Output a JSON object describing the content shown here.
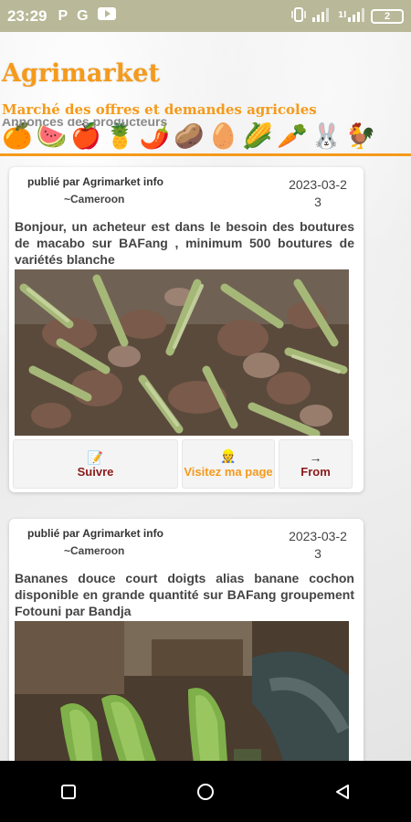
{
  "status_bar": {
    "time": "23:29",
    "left_icons": [
      "P",
      "G",
      "▶"
    ],
    "battery": "2"
  },
  "header": {
    "title": "Agrimarket",
    "subtitle": "Marché des offres et demandes agricoles",
    "emojis": [
      "🍊",
      "🍉",
      "🍎",
      "🍍",
      "🌶️",
      "🥔",
      "🥚",
      "🌽",
      "🥕",
      "🐰",
      "🐓"
    ]
  },
  "section": {
    "heading": "Annonces des producteurs"
  },
  "posts": [
    {
      "author": "publié par Agrimarket info",
      "location": "~Cameroon",
      "date": "2023-03-23",
      "text": "Bonjour, un acheteur est dans le besoin des boutures de macabo sur BAFang , minimum 500 boutures de variétés blanche",
      "actions": {
        "follow_icon": "📝",
        "follow_label": "Suivre",
        "visit_icon": "👷",
        "visit_label": "Visitez ma page",
        "from_icon": "→",
        "from_label": "From"
      }
    },
    {
      "author": "publié par Agrimarket info",
      "location": "~Cameroon",
      "date": "2023-03-23",
      "text": "Bananes douce court doigts alias banane cochon disponible en grande quantité sur BAFang groupement Fotouni par Bandja"
    }
  ],
  "colors": {
    "accent": "#f59a1b",
    "status_bar": "#b9b898",
    "follow_text": "#8b1a1a"
  },
  "icons": {
    "nav": [
      "recent-apps-icon",
      "home-icon",
      "back-icon"
    ]
  }
}
